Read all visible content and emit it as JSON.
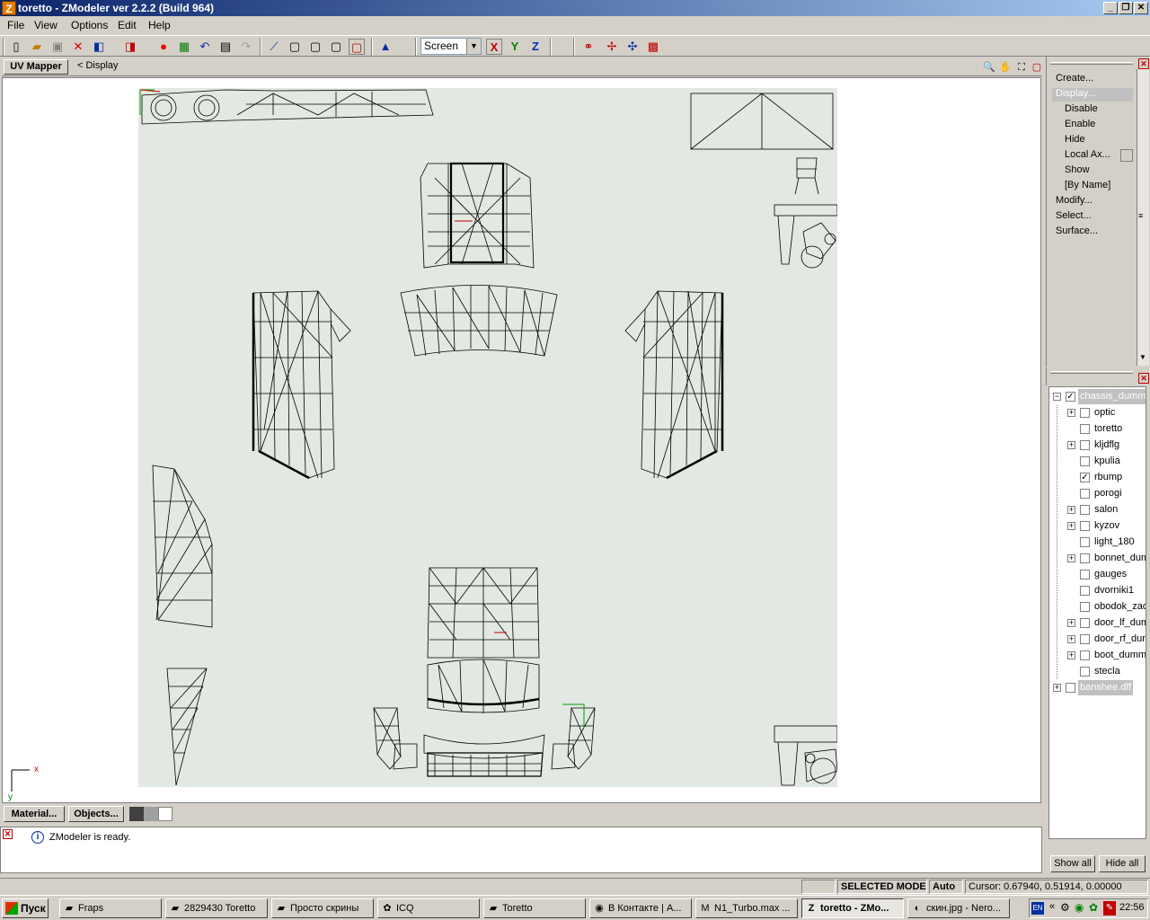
{
  "window": {
    "title": "toretto - ZModeler ver 2.2.2 (Build 964)",
    "app_icon": "Z",
    "minimize": "_",
    "restore": "❐",
    "close": "✕"
  },
  "menu": [
    "File",
    "View",
    "Options",
    "Edit",
    "Help"
  ],
  "toolbar": {
    "icons": [
      "new-icon",
      "open-icon",
      "save-icon",
      "delete-icon",
      "import-icon",
      "export-icon",
      "material-icon",
      "texture-icon",
      "undo-icon",
      "properties-icon",
      "redo-icon",
      "vertex-icon",
      "box-icon",
      "box2-icon",
      "box3-icon",
      "box4-icon",
      "axis-icon"
    ],
    "view_select": "Screen",
    "axis_x": "X",
    "axis_y": "Y",
    "axis_z": "Z"
  },
  "uv_panel": {
    "tab": "UV Mapper",
    "crumb": "< Display",
    "axis_x_label": "x",
    "axis_y_label": "y"
  },
  "bottom_tabs": {
    "material": "Material...",
    "objects": "Objects..."
  },
  "log": {
    "message": "ZModeler is ready."
  },
  "commands": {
    "create": "Create...",
    "display": "Display...",
    "display_items": [
      "Disable",
      "Enable",
      "Hide",
      "Local Ax...",
      "Show",
      "[By Name]"
    ],
    "modify": "Modify...",
    "select": "Select...",
    "surface": "Surface..."
  },
  "tree": {
    "root": "chassis_dummy",
    "children": [
      {
        "label": "optic",
        "expand": true,
        "checked": false
      },
      {
        "label": "toretto",
        "expand": false,
        "checked": false
      },
      {
        "label": "kljdflg",
        "expand": true,
        "checked": false
      },
      {
        "label": "kpulia",
        "expand": false,
        "checked": false
      },
      {
        "label": "rbump",
        "expand": false,
        "checked": true
      },
      {
        "label": "porogi",
        "expand": false,
        "checked": false
      },
      {
        "label": "salon",
        "expand": true,
        "checked": false
      },
      {
        "label": "kyzov",
        "expand": true,
        "checked": false
      },
      {
        "label": "light_180",
        "expand": false,
        "checked": false
      },
      {
        "label": "bonnet_dum",
        "expand": true,
        "checked": false
      },
      {
        "label": "gauges",
        "expand": false,
        "checked": false
      },
      {
        "label": "dvorniki1",
        "expand": false,
        "checked": false
      },
      {
        "label": "obodok_zad",
        "expand": false,
        "checked": false
      },
      {
        "label": "door_lf_dum",
        "expand": true,
        "checked": false
      },
      {
        "label": "door_rf_dun",
        "expand": true,
        "checked": false
      },
      {
        "label": "boot_dummy",
        "expand": true,
        "checked": false
      },
      {
        "label": "stecla",
        "expand": false,
        "checked": false
      }
    ],
    "second_root": "banshee.dff",
    "show_all": "Show all",
    "hide_all": "Hide all"
  },
  "status": {
    "mode": "SELECTED MODE",
    "auto": "Auto",
    "cursor": "Cursor: 0.67940, 0.51914, 0.00000"
  },
  "taskbar": {
    "start": "Пуск",
    "tasks": [
      {
        "label": "Fraps",
        "icon": "folder-icon"
      },
      {
        "label": "2829430 Toretto",
        "icon": "folder-icon"
      },
      {
        "label": "Просто скрины",
        "icon": "folder-icon"
      },
      {
        "label": "ICQ",
        "icon": "icq-icon"
      },
      {
        "label": "Toretto",
        "icon": "folder-icon"
      },
      {
        "label": "В Контакте | А...",
        "icon": "firefox-icon"
      },
      {
        "label": "N1_Turbo.max ...",
        "icon": "max-icon"
      },
      {
        "label": "toretto - ZMo...",
        "icon": "zmodeler-icon"
      },
      {
        "label": "скин.jpg - Nero...",
        "icon": "nero-icon"
      }
    ],
    "lang": "EN",
    "clock": "22:56"
  },
  "colors": {
    "title_start": "#0a246a",
    "title_end": "#a6caf0",
    "uv_bg": "#e2e8e2",
    "selection": "#c0c0c0"
  }
}
